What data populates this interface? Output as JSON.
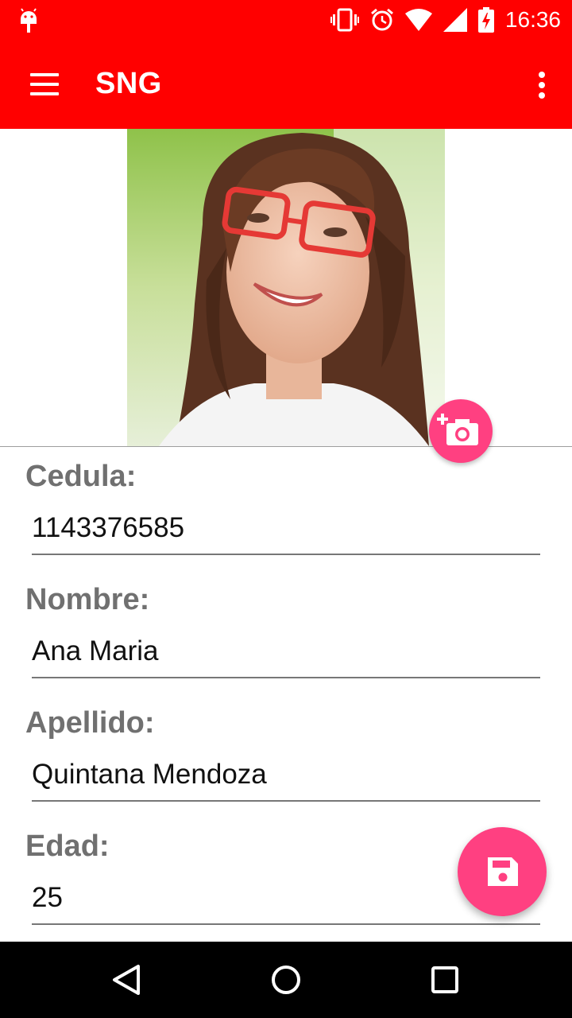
{
  "status_bar": {
    "time": "16:36",
    "icons": [
      "android-debug-icon",
      "vibrate-icon",
      "alarm-icon",
      "wifi-icon",
      "cell-signal-icon",
      "battery-charging-icon"
    ]
  },
  "app_bar": {
    "title": "SNG",
    "menu_icon": "hamburger-menu-icon",
    "overflow_icon": "more-vert-icon"
  },
  "profile": {
    "photo_icon": "profile-photo",
    "add_photo_icon": "add-a-photo-icon"
  },
  "form": {
    "cedula_label": "Cedula:",
    "cedula_value": "1143376585",
    "nombre_label": "Nombre:",
    "nombre_value": "Ana Maria",
    "apellido_label": "Apellido:",
    "apellido_value": "Quintana Mendoza",
    "edad_label": "Edad:",
    "edad_value": "25"
  },
  "save_fab": {
    "icon": "save-icon"
  },
  "nav_bar": {
    "icons": [
      "back-icon",
      "home-icon",
      "recents-icon"
    ]
  },
  "colors": {
    "primary": "#ff0000",
    "accent": "#ff4081",
    "label": "#707070",
    "nav_background": "#000000"
  }
}
